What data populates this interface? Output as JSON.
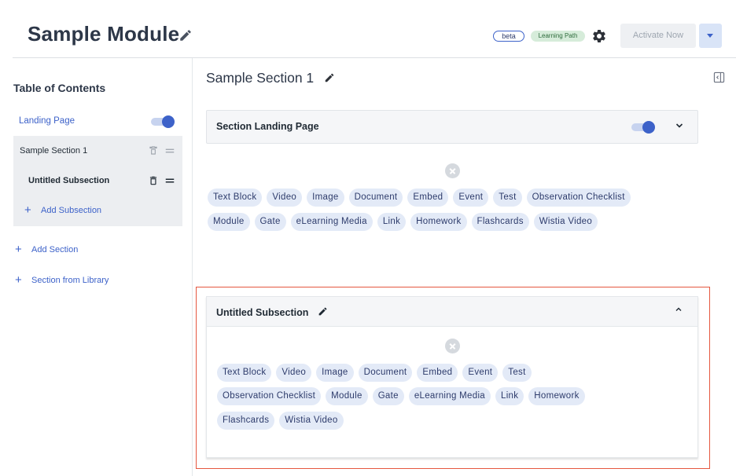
{
  "header": {
    "title": "Sample Module",
    "badges": [
      "beta",
      "Learning Path"
    ],
    "activate_label": "Activate Now"
  },
  "sidebar": {
    "heading": "Table of Contents",
    "landing_page": {
      "label": "Landing Page",
      "enabled": true
    },
    "section": {
      "label": "Sample Section 1"
    },
    "subsection": {
      "label": "Untitled Subsection"
    },
    "add_subsection_label": "Add Subsection",
    "add_section_label": "Add Section",
    "section_from_library_label": "Section from Library"
  },
  "main": {
    "section_title": "Sample Section 1",
    "landing_card": {
      "title": "Section Landing Page",
      "enabled": true
    },
    "content_types": [
      "Text Block",
      "Video",
      "Image",
      "Document",
      "Embed",
      "Event",
      "Test",
      "Observation Checklist",
      "Module",
      "Gate",
      "eLearning Media",
      "Link",
      "Homework",
      "Flashcards",
      "Wistia Video"
    ],
    "subsection_card": {
      "title": "Untitled Subsection"
    }
  },
  "colors": {
    "accent": "#3d62c9",
    "chip_bg": "#e3eaf7",
    "badge_green_bg": "#d6ecda",
    "highlight": "#e5573f"
  }
}
